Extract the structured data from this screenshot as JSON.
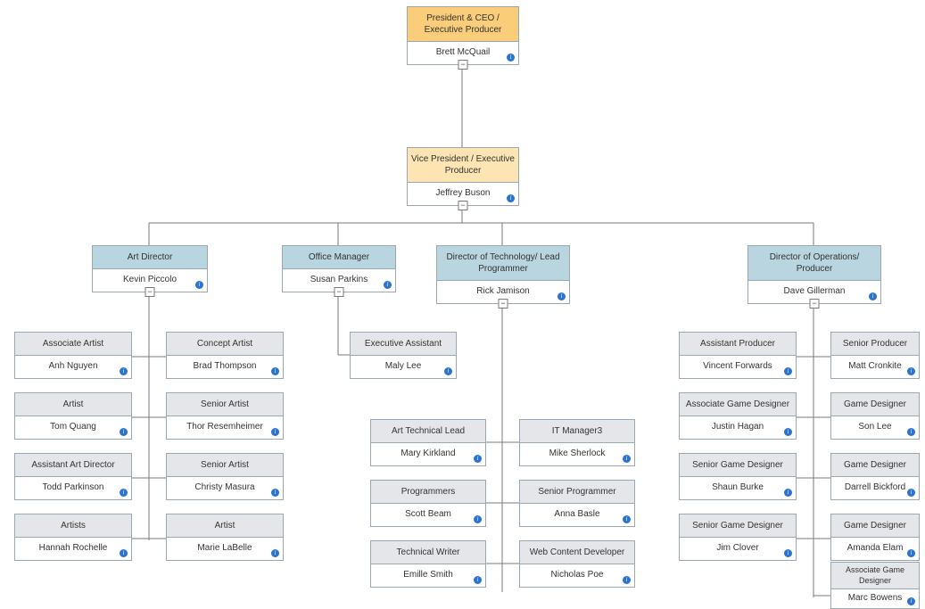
{
  "ceo": {
    "title": "President & CEO / Executive Producer",
    "name": "Brett McQuail"
  },
  "vp": {
    "title": "Vice President / Executive Producer",
    "name": "Jeffrey Buson"
  },
  "directors": {
    "art": {
      "title": "Art Director",
      "name": "Kevin Piccolo"
    },
    "office": {
      "title": "Office Manager",
      "name": "Susan Parkins"
    },
    "tech": {
      "title": "Director of Technology/ Lead Programmer",
      "name": "Rick Jamison"
    },
    "ops": {
      "title": "Director of Operations/ Producer",
      "name": "Dave Gillerman"
    }
  },
  "art_left": [
    {
      "title": "Associate Artist",
      "name": "Anh Nguyen"
    },
    {
      "title": "Artist",
      "name": "Tom Quang"
    },
    {
      "title": "Assistant Art Director",
      "name": "Todd Parkinson"
    },
    {
      "title": "Artists",
      "name": "Hannah Rochelle"
    }
  ],
  "art_right": [
    {
      "title": "Concept Artist",
      "name": "Brad Thompson"
    },
    {
      "title": "Senior Artist",
      "name": "Thor Resemheimer"
    },
    {
      "title": "Senior Artist",
      "name": "Christy Masura"
    },
    {
      "title": "Artist",
      "name": "Marie LaBelle"
    }
  ],
  "office_children": [
    {
      "title": "Executive Assistant",
      "name": "Maly Lee"
    }
  ],
  "tech_left": [
    {
      "title": "Art Technical Lead",
      "name": "Mary Kirkland"
    },
    {
      "title": "Programmers",
      "name": "Scott Beam"
    },
    {
      "title": "Technical Writer",
      "name": "Emille Smith"
    }
  ],
  "tech_right": [
    {
      "title": "IT Manager3",
      "name": "Mike Sherlock"
    },
    {
      "title": "Senior Programmer",
      "name": "Anna Basle"
    },
    {
      "title": "Web Content Developer",
      "name": "Nicholas Poe"
    }
  ],
  "ops_left": [
    {
      "title": "Assistant Producer",
      "name": "Vincent Forwards"
    },
    {
      "title": "Associate Game Designer",
      "name": "Justin Hagan"
    },
    {
      "title": "Senior Game Designer",
      "name": "Shaun Burke"
    },
    {
      "title": "Senior Game Designer",
      "name": "Jim Clover"
    }
  ],
  "ops_right": [
    {
      "title": "Senior Producer",
      "name": "Matt Cronkite"
    },
    {
      "title": "Game Designer",
      "name": "Son Lee"
    },
    {
      "title": "Game Designer",
      "name": "Darrell Bickford"
    },
    {
      "title": "Game Designer",
      "name": "Amanda Elam"
    },
    {
      "title": "Associate Game Designer",
      "name": "Marc Bowens"
    }
  ],
  "toggle_glyph": "−"
}
